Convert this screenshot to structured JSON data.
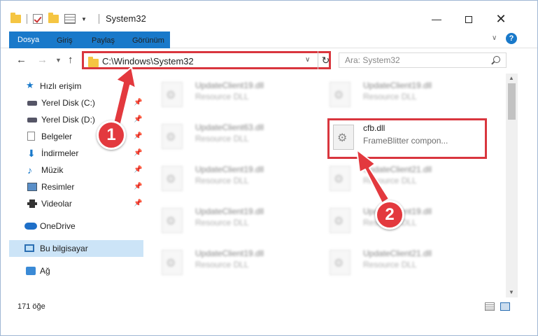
{
  "window": {
    "title": "System32",
    "minimize": "—",
    "maximize": "",
    "close": "✕"
  },
  "ribbon": {
    "tabs": [
      "Dosya",
      "Giriş",
      "Paylaş",
      "Görünüm"
    ],
    "help": "?"
  },
  "address": {
    "path": "C:\\Windows\\System32",
    "search_placeholder": "Ara: System32"
  },
  "sidebar": {
    "items": [
      {
        "label": "Hızlı erişim",
        "icon": "star-icon",
        "pinned": false
      },
      {
        "label": "Yerel Disk (C:)",
        "icon": "drive-icon",
        "pinned": true
      },
      {
        "label": "Yerel Disk (D:)",
        "icon": "drive-icon",
        "pinned": true
      },
      {
        "label": "Belgeler",
        "icon": "document-icon",
        "pinned": true
      },
      {
        "label": "İndirmeler",
        "icon": "download-icon",
        "pinned": true
      },
      {
        "label": "Müzik",
        "icon": "music-icon",
        "pinned": true
      },
      {
        "label": "Resimler",
        "icon": "pictures-icon",
        "pinned": true
      },
      {
        "label": "Videolar",
        "icon": "videos-icon",
        "pinned": true
      },
      {
        "label": "OneDrive",
        "icon": "cloud-icon",
        "pinned": false
      },
      {
        "label": "Bu bilgisayar",
        "icon": "computer-icon",
        "pinned": false,
        "selected": true
      },
      {
        "label": "Ağ",
        "icon": "network-icon",
        "pinned": false
      }
    ]
  },
  "files": {
    "left": [
      {
        "name": "UpdateClient19.dll",
        "desc": "Resource DLL"
      },
      {
        "name": "UpdateClient63.dll",
        "desc": "Resource DLL"
      },
      {
        "name": "UpdateClient19.dll",
        "desc": "Resource DLL"
      },
      {
        "name": "UpdateClient19.dll",
        "desc": "Resource DLL"
      },
      {
        "name": "UpdateClient19.dll",
        "desc": "Resource DLL"
      }
    ],
    "right": [
      {
        "name": "UpdateClient19.dll",
        "desc": "Resource DLL"
      },
      {
        "name": "cfb.dll",
        "desc": "FrameBlitter compon..."
      },
      {
        "name": "UpdateClient21.dll",
        "desc": "Resource DLL"
      },
      {
        "name": "UpdateClient19.dll",
        "desc": "Resource DLL"
      },
      {
        "name": "UpdateClient21.dll",
        "desc": "Resource DLL"
      }
    ]
  },
  "status": {
    "count": "171 öğe"
  },
  "annotations": {
    "step1": "1",
    "step2": "2",
    "color": "#e3393e"
  }
}
